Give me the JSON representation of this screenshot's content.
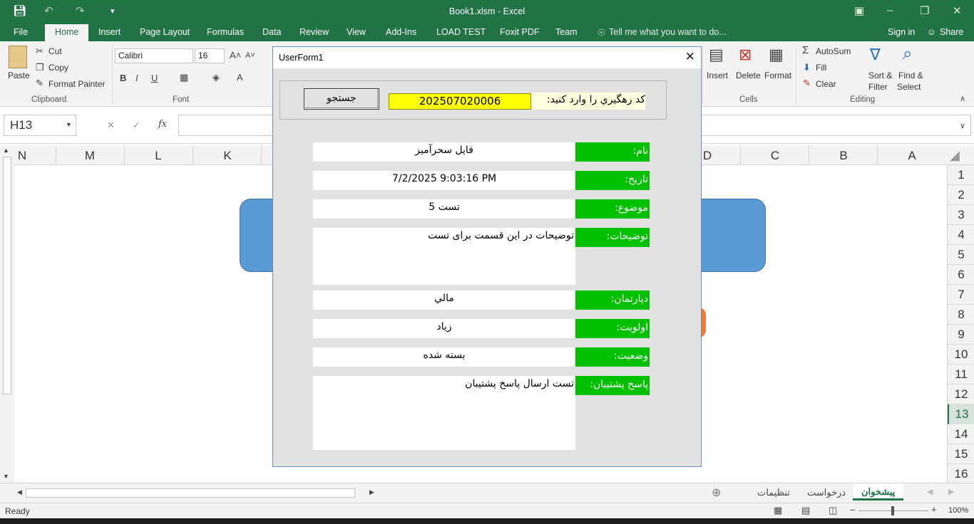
{
  "window": {
    "title": "Book1.xlsm - Excel"
  },
  "ribbon_tabs": [
    "File",
    "Home",
    "Insert",
    "Page Layout",
    "Formulas",
    "Data",
    "Review",
    "View",
    "Add-Ins",
    "LOAD TEST",
    "Foxit PDF",
    "Team"
  ],
  "tell_me": "Tell me what you want to do...",
  "account": {
    "sign_in": "Sign in",
    "share": "Share"
  },
  "clipboard": {
    "paste": "Paste",
    "cut": "Cut",
    "copy": "Copy",
    "format_painter": "Format Painter",
    "group_label": "Clipboard"
  },
  "font": {
    "name": "Calibri",
    "size": "16",
    "group_label": "Font"
  },
  "cells_group": {
    "insert": "Insert",
    "delete": "Delete",
    "format": "Format",
    "group_label": "Cells"
  },
  "editing": {
    "autosum": "AutoSum",
    "fill": "Fill",
    "clear": "Clear",
    "sort_filter_1": "Sort &",
    "sort_filter_2": "Filter",
    "find_select_1": "Find &",
    "find_select_2": "Select",
    "group_label": "Editing"
  },
  "formula_bar": {
    "name_box": "H13",
    "fx": "fx"
  },
  "columns": [
    "N",
    "M",
    "L",
    "K",
    "D",
    "C",
    "B",
    "A"
  ],
  "rows": [
    "1",
    "2",
    "3",
    "4",
    "5",
    "6",
    "7",
    "8",
    "9",
    "10",
    "11",
    "12",
    "13",
    "14",
    "15",
    "16"
  ],
  "selected_row": "13",
  "sheet_tabs": [
    "تنظيمات",
    "درخواست",
    "پیشخوان"
  ],
  "active_sheet": "پیشخوان",
  "status": {
    "ready": "Ready",
    "zoom": "100%"
  },
  "userform": {
    "title": "UserForm1",
    "search_button": "جستجو",
    "search_label": "کد رهگيري را وارد کنید:",
    "search_value": "202507020006",
    "fields": [
      {
        "label": "نام:",
        "value": "فایل سحرآمیز"
      },
      {
        "label": "تاریخ:",
        "value": "7/2/2025 9:03:16 PM"
      },
      {
        "label": "موضوع:",
        "value": "تست 5"
      },
      {
        "label": "توضیحات:",
        "value": "توضیحات در این قسمت برای تست"
      },
      {
        "label": "دپارتمان:",
        "value": "مالي"
      },
      {
        "label": "اولویت:",
        "value": "زیاد"
      },
      {
        "label": "وضعیت:",
        "value": "بسته شده"
      },
      {
        "label": "پاسخ پشتیبان:",
        "value": "تست ارسال پاسخ پشتیبان"
      }
    ]
  },
  "colors": {
    "excel_green": "#217346",
    "label_green": "#00c000",
    "search_yellow": "#ffff00",
    "shape_blue": "#5b9bd5",
    "shape_orange": "#ed7d31"
  }
}
